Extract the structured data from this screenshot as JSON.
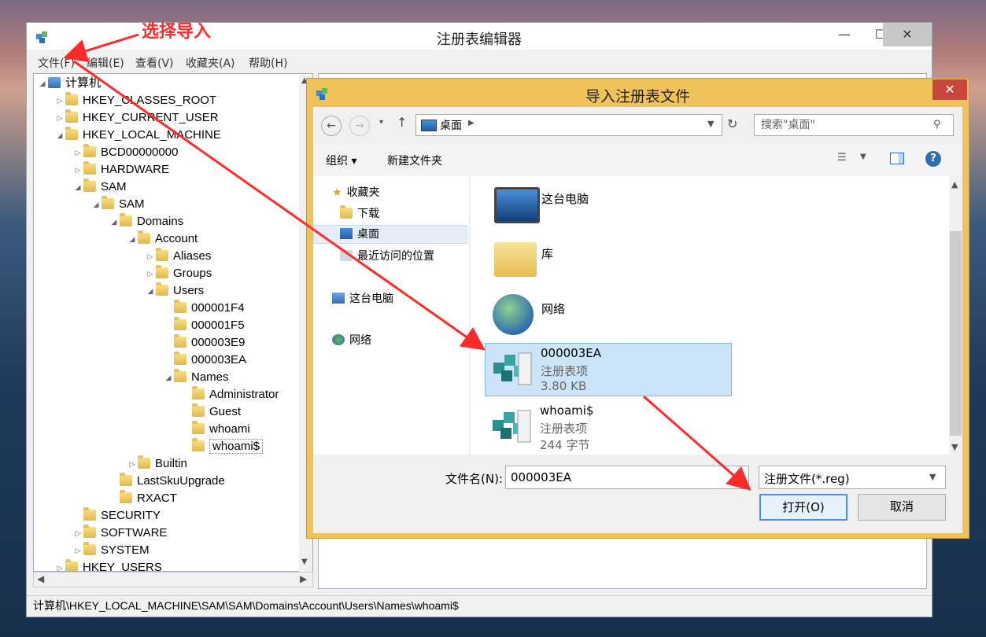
{
  "annotation": {
    "text": "选择导入"
  },
  "regedit": {
    "title": "注册表编辑器",
    "controls": {
      "minimize": "—",
      "maximize": "☐",
      "close": "✕"
    },
    "menu": [
      "文件(F)",
      "编辑(E)",
      "查看(V)",
      "收藏夹(A)",
      "帮助(H)"
    ],
    "tree": [
      {
        "label": "计算机",
        "indent": 0,
        "expanded": true
      },
      {
        "label": "HKEY_CLASSES_ROOT",
        "indent": 1
      },
      {
        "label": "HKEY_CURRENT_USER",
        "indent": 1
      },
      {
        "label": "HKEY_LOCAL_MACHINE",
        "indent": 1,
        "expanded": true
      },
      {
        "label": "BCD00000000",
        "indent": 2
      },
      {
        "label": "HARDWARE",
        "indent": 2
      },
      {
        "label": "SAM",
        "indent": 2,
        "expanded": true
      },
      {
        "label": "SAM",
        "indent": 3,
        "expanded": true
      },
      {
        "label": "Domains",
        "indent": 4,
        "expanded": true
      },
      {
        "label": "Account",
        "indent": 5,
        "expanded": true
      },
      {
        "label": "Aliases",
        "indent": 6
      },
      {
        "label": "Groups",
        "indent": 6
      },
      {
        "label": "Users",
        "indent": 6,
        "expanded": true
      },
      {
        "label": "000001F4",
        "indent": 7
      },
      {
        "label": "000001F5",
        "indent": 7
      },
      {
        "label": "000003E9",
        "indent": 7
      },
      {
        "label": "000003EA",
        "indent": 7
      },
      {
        "label": "Names",
        "indent": 7,
        "expanded": true
      },
      {
        "label": "Administrator",
        "indent": 8
      },
      {
        "label": "Guest",
        "indent": 8
      },
      {
        "label": "whoami",
        "indent": 8
      },
      {
        "label": "whoami$",
        "indent": 8,
        "selected": true
      },
      {
        "label": "Builtin",
        "indent": 5
      },
      {
        "label": "LastSkuUpgrade",
        "indent": 4
      },
      {
        "label": "RXACT",
        "indent": 4
      },
      {
        "label": "SECURITY",
        "indent": 2
      },
      {
        "label": "SOFTWARE",
        "indent": 2
      },
      {
        "label": "SYSTEM",
        "indent": 2
      },
      {
        "label": "HKEY_USERS",
        "indent": 1
      }
    ],
    "status": "计算机\\HKEY_LOCAL_MACHINE\\SAM\\SAM\\Domains\\Account\\Users\\Names\\whoami$"
  },
  "dialog": {
    "title": "导入注册表文件",
    "close": "✕",
    "address": "桌面",
    "search_placeholder": "搜索\"桌面\"",
    "toolbar": {
      "organize": "组织 ▾",
      "new_folder": "新建文件夹"
    },
    "nav": [
      {
        "label": "收藏夹",
        "icon": "star-icon"
      },
      {
        "label": "下载",
        "icon": "download-folder-icon"
      },
      {
        "label": "桌面",
        "icon": "desktop-icon",
        "selected": true
      },
      {
        "label": "最近访问的位置",
        "icon": "recent-places-icon"
      },
      {
        "label": "这台电脑",
        "icon": "computer-icon"
      },
      {
        "label": "网络",
        "icon": "network-icon"
      }
    ],
    "files": [
      {
        "name": "这台电脑",
        "icon": "computer-icon"
      },
      {
        "name": "库",
        "icon": "library-icon"
      },
      {
        "name": "网络",
        "icon": "network-icon"
      },
      {
        "name": "000003EA",
        "type": "注册表项",
        "size": "3.80 KB",
        "icon": "registry-file-icon",
        "selected": true
      },
      {
        "name": "whoami$",
        "type": "注册表项",
        "size": "244 字节",
        "icon": "registry-file-icon"
      }
    ],
    "filename_label": "文件名(N):",
    "filename_value": "000003EA",
    "filetype_value": "注册文件(*.reg)",
    "open_button": "打开(O)",
    "cancel_button": "取消"
  },
  "colors": {
    "accent_arrow": "#ff2b2b",
    "dialog_frame": "#f0c35a",
    "selection": "#cce4f7"
  }
}
